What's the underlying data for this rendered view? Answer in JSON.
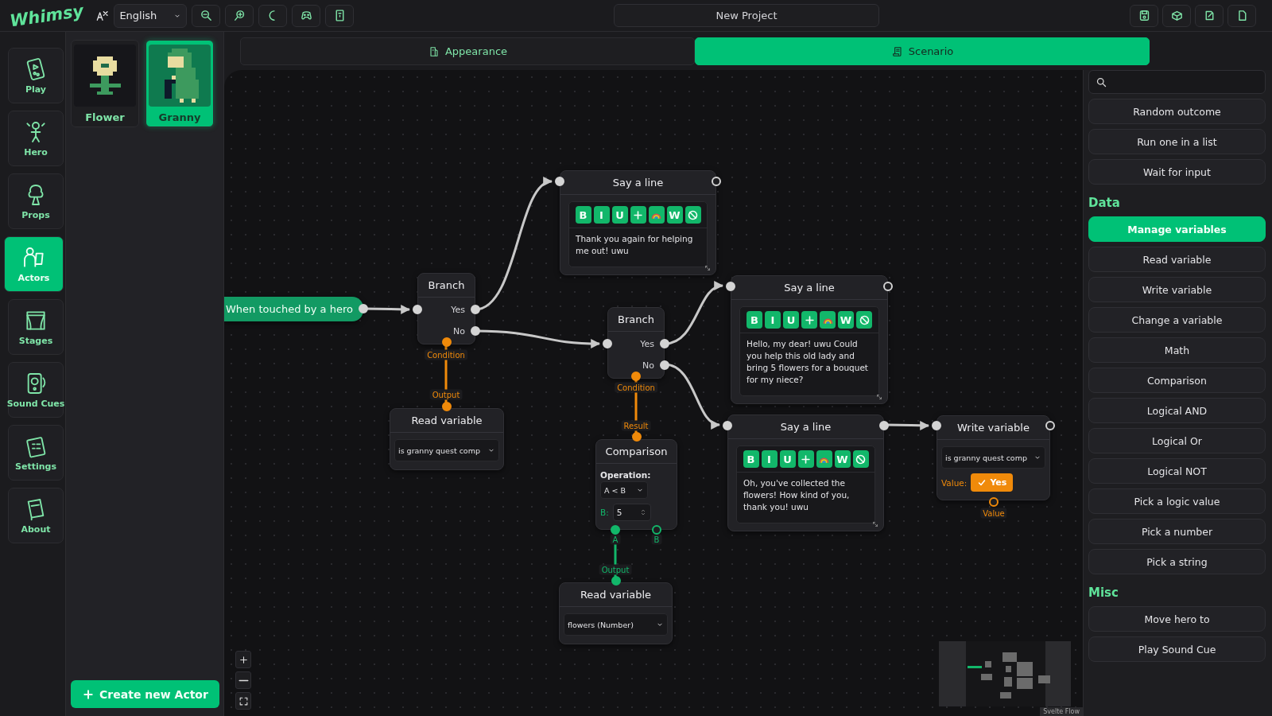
{
  "app": {
    "logo": "Whimsy",
    "language": "English",
    "project_title": "New Project"
  },
  "nav": [
    {
      "label": "Play",
      "selected": false
    },
    {
      "label": "Hero",
      "selected": false
    },
    {
      "label": "Props",
      "selected": false
    },
    {
      "label": "Actors",
      "selected": true
    },
    {
      "label": "Stages",
      "selected": false
    },
    {
      "label": "Sound Cues",
      "selected": false
    },
    {
      "label": "Settings",
      "selected": false
    },
    {
      "label": "About",
      "selected": false
    }
  ],
  "actors": [
    {
      "name": "Flower",
      "selected": false
    },
    {
      "name": "Granny",
      "selected": true
    }
  ],
  "create_button": "Create new Actor",
  "tabs": [
    {
      "label": "Appearance",
      "selected": false
    },
    {
      "label": "Scenario",
      "selected": true
    }
  ],
  "nodes": [
    {
      "kind": "trigger",
      "title": "When touched by a hero"
    },
    {
      "kind": "branch",
      "title": "Branch",
      "outputs": [
        "Yes",
        "No"
      ],
      "port_label": "Condition"
    },
    {
      "kind": "say",
      "title": "Say a line",
      "text": "Thank you again for helping me out! uwu",
      "toolbar": [
        {
          "kind": "text",
          "label": "B"
        },
        {
          "kind": "text",
          "label": "I"
        },
        {
          "kind": "text",
          "label": "U"
        },
        {
          "kind": "plus"
        },
        {
          "kind": "rainbow"
        },
        {
          "kind": "text",
          "label": "W"
        },
        {
          "kind": "clear"
        }
      ]
    },
    {
      "kind": "branch",
      "title": "Branch",
      "outputs": [
        "Yes",
        "No"
      ],
      "port_label": "Condition"
    },
    {
      "kind": "say",
      "title": "Say a line",
      "text": "Hello, my dear! uwu Could you help this old lady and bring 5 flowers for a bouquet for my niece?",
      "toolbar": [
        {
          "kind": "text",
          "label": "B"
        },
        {
          "kind": "text",
          "label": "I"
        },
        {
          "kind": "text",
          "label": "U"
        },
        {
          "kind": "plus"
        },
        {
          "kind": "rainbow"
        },
        {
          "kind": "text",
          "label": "W"
        },
        {
          "kind": "clear"
        }
      ]
    },
    {
      "kind": "read",
      "title": "Read variable",
      "variable": "is granny quest comp",
      "port_label": "Output"
    },
    {
      "kind": "comparison",
      "title": "Comparison",
      "operation_label": "Operation:",
      "operation": "A < B",
      "b_label": "B:",
      "b_value": "5",
      "port_label": "Result",
      "inputs": [
        "A",
        "B"
      ]
    },
    {
      "kind": "say",
      "title": "Say a line",
      "text": "Oh, you've collected the flowers! How kind of you, thank you! uwu",
      "toolbar": [
        {
          "kind": "text",
          "label": "B"
        },
        {
          "kind": "text",
          "label": "I"
        },
        {
          "kind": "text",
          "label": "U"
        },
        {
          "kind": "plus"
        },
        {
          "kind": "rainbow"
        },
        {
          "kind": "text",
          "label": "W"
        },
        {
          "kind": "clear"
        }
      ]
    },
    {
      "kind": "write",
      "title": "Write variable",
      "variable": "is granny quest comp",
      "value_label": "Value:",
      "value": "Yes",
      "checked": true,
      "port_label": "Value"
    },
    {
      "kind": "read",
      "title": "Read variable",
      "variable": "flowers (Number)",
      "port_label": "Output"
    }
  ],
  "attribution": "Svelte Flow",
  "palette": [
    {
      "kind": "item",
      "label": "Random outcome"
    },
    {
      "kind": "item",
      "label": "Run one in a list"
    },
    {
      "kind": "item",
      "label": "Wait for input"
    },
    {
      "kind": "heading",
      "label": "Data"
    },
    {
      "kind": "primary",
      "label": "Manage variables"
    },
    {
      "kind": "item",
      "label": "Read variable"
    },
    {
      "kind": "item",
      "label": "Write variable"
    },
    {
      "kind": "item",
      "label": "Change a variable"
    },
    {
      "kind": "item",
      "label": "Math"
    },
    {
      "kind": "item",
      "label": "Comparison"
    },
    {
      "kind": "item",
      "label": "Logical AND"
    },
    {
      "kind": "item",
      "label": "Logical Or"
    },
    {
      "kind": "item",
      "label": "Logical NOT"
    },
    {
      "kind": "item",
      "label": "Pick a logic value"
    },
    {
      "kind": "item",
      "label": "Pick a number"
    },
    {
      "kind": "item",
      "label": "Pick a string"
    },
    {
      "kind": "heading",
      "label": "Misc"
    },
    {
      "kind": "item",
      "label": "Move hero to"
    },
    {
      "kind": "item",
      "label": "Play Sound Cue"
    }
  ]
}
